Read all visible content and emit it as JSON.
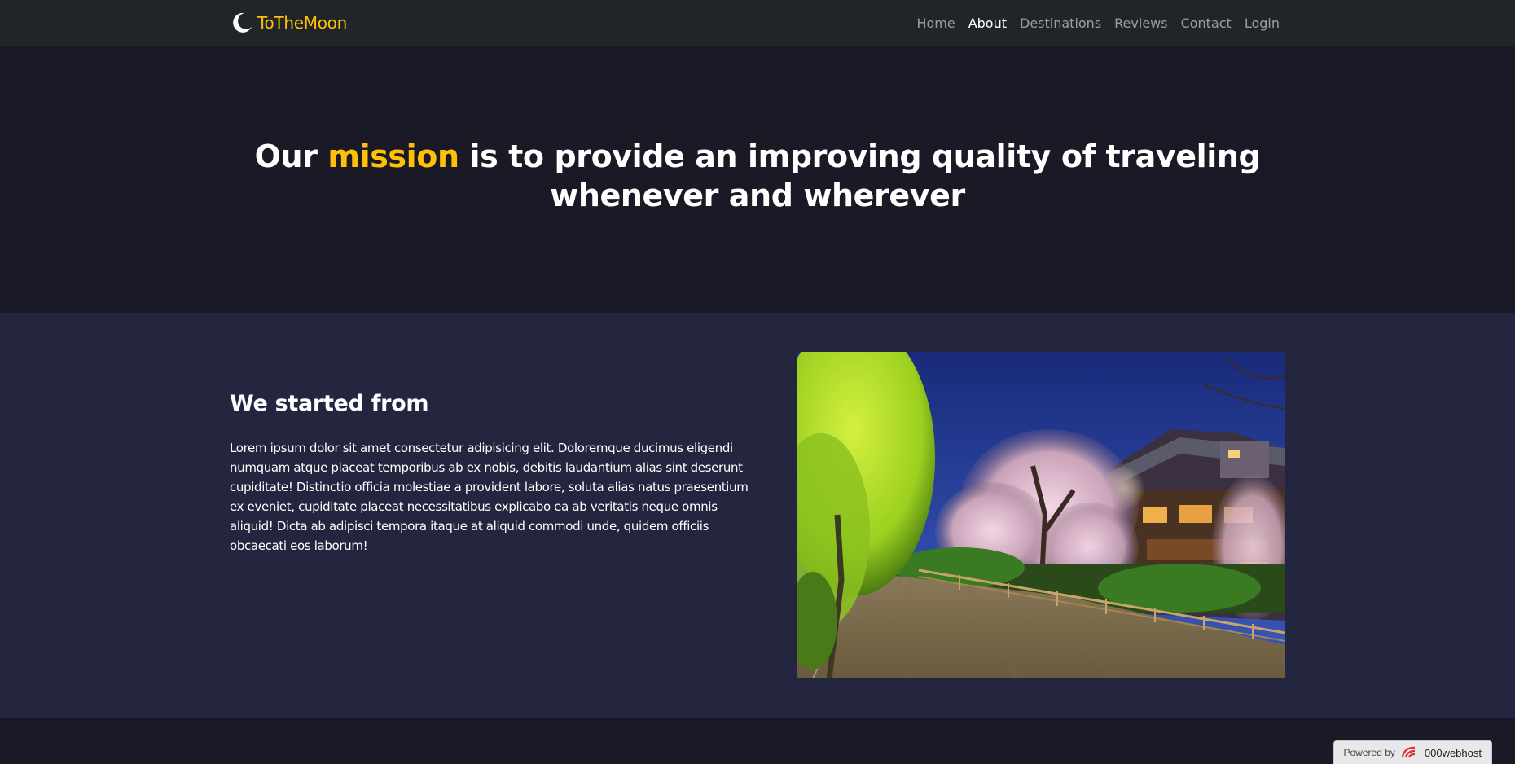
{
  "brand": {
    "name": "ToTheMoon",
    "icon": "moon-icon",
    "color": "#ffc107"
  },
  "nav": {
    "items": [
      {
        "label": "Home",
        "active": false
      },
      {
        "label": "About",
        "active": true
      },
      {
        "label": "Destinations",
        "active": false
      },
      {
        "label": "Reviews",
        "active": false
      },
      {
        "label": "Contact",
        "active": false
      },
      {
        "label": "Login",
        "active": false
      }
    ]
  },
  "hero": {
    "title_prefix": "Our ",
    "title_accent": "mission",
    "title_suffix": " is to provide an improving quality of traveling whenever and wherever"
  },
  "about": {
    "heading": "We started from",
    "body": "Lorem ipsum dolor sit amet consectetur adipisicing elit. Doloremque ducimus eligendi numquam atque placeat temporibus ab ex nobis, debitis laudantium alias sint deserunt cupiditate! Distinctio officia molestiae a provident labore, soluta alias natus praesentium ex eveniet, cupiditate placeat necessitatibus explicabo ea ab veritatis neque omnis aliquid! Dicta ab adipisci tempora itaque at aliquid commodi unde, quidem officiis obcaecati eos laborum!",
    "image": "night-street-cherry-blossom-photo"
  },
  "badge": {
    "label": "Powered by",
    "brand": "000webhost",
    "icon": "000webhost-logo-icon"
  },
  "colors": {
    "navbar": "#212529",
    "hero_bg": "#1a1a26",
    "about_bg": "#242640",
    "accent": "#ffc107"
  }
}
